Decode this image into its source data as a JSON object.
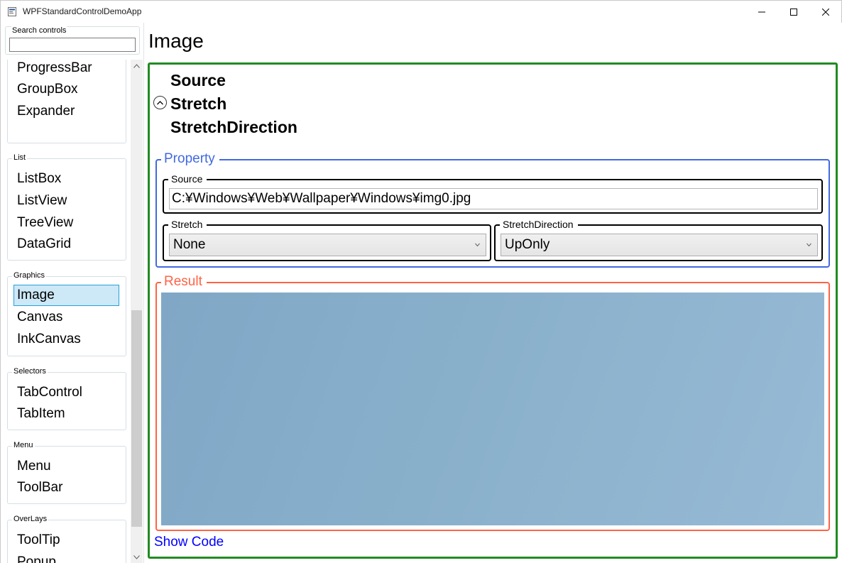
{
  "window": {
    "title": "WPFStandardControlDemoApp",
    "icon": "app-icon",
    "controls": [
      "minimize-icon",
      "maximize-icon",
      "close-icon"
    ]
  },
  "sidebar": {
    "search": {
      "label": "Search controls",
      "value": ""
    },
    "groups": [
      {
        "title": "",
        "items": [
          {
            "label": "ProgressBar"
          },
          {
            "label": "GroupBox"
          },
          {
            "label": "Expander"
          }
        ]
      },
      {
        "title": "List",
        "items": [
          {
            "label": "ListBox"
          },
          {
            "label": "ListView"
          },
          {
            "label": "TreeView"
          },
          {
            "label": "DataGrid"
          }
        ]
      },
      {
        "title": "Graphics",
        "items": [
          {
            "label": "Image",
            "selected": true
          },
          {
            "label": "Canvas"
          },
          {
            "label": "InkCanvas"
          }
        ]
      },
      {
        "title": "Selectors",
        "items": [
          {
            "label": "TabControl"
          },
          {
            "label": "TabItem"
          }
        ]
      },
      {
        "title": "Menu",
        "items": [
          {
            "label": "Menu"
          },
          {
            "label": "ToolBar"
          }
        ]
      },
      {
        "title": "OverLays",
        "items": [
          {
            "label": "ToolTip"
          },
          {
            "label": "Popup"
          }
        ]
      }
    ]
  },
  "main": {
    "title": "Image",
    "properties": [
      "Source",
      "Stretch",
      "StretchDirection"
    ],
    "expander_icon": "chevron-up-circle-icon",
    "property_group": {
      "title": "Property",
      "source": {
        "label": "Source",
        "value": "C:¥Windows¥Web¥Wallpaper¥Windows¥img0.jpg"
      },
      "stretch": {
        "label": "Stretch",
        "selected": "None"
      },
      "stretch_direction": {
        "label": "StretchDirection",
        "selected": "UpOnly"
      }
    },
    "result_group": {
      "title": "Result"
    },
    "show_code": "Show Code"
  },
  "colors": {
    "content_border": "#228b22",
    "property_group": "#4169e1",
    "result_group": "#ff6347",
    "link": "#0000ff",
    "selected_item_bg": "#cde8f7",
    "selected_item_border": "#26a0da",
    "image_tint": "#89b0cb"
  }
}
